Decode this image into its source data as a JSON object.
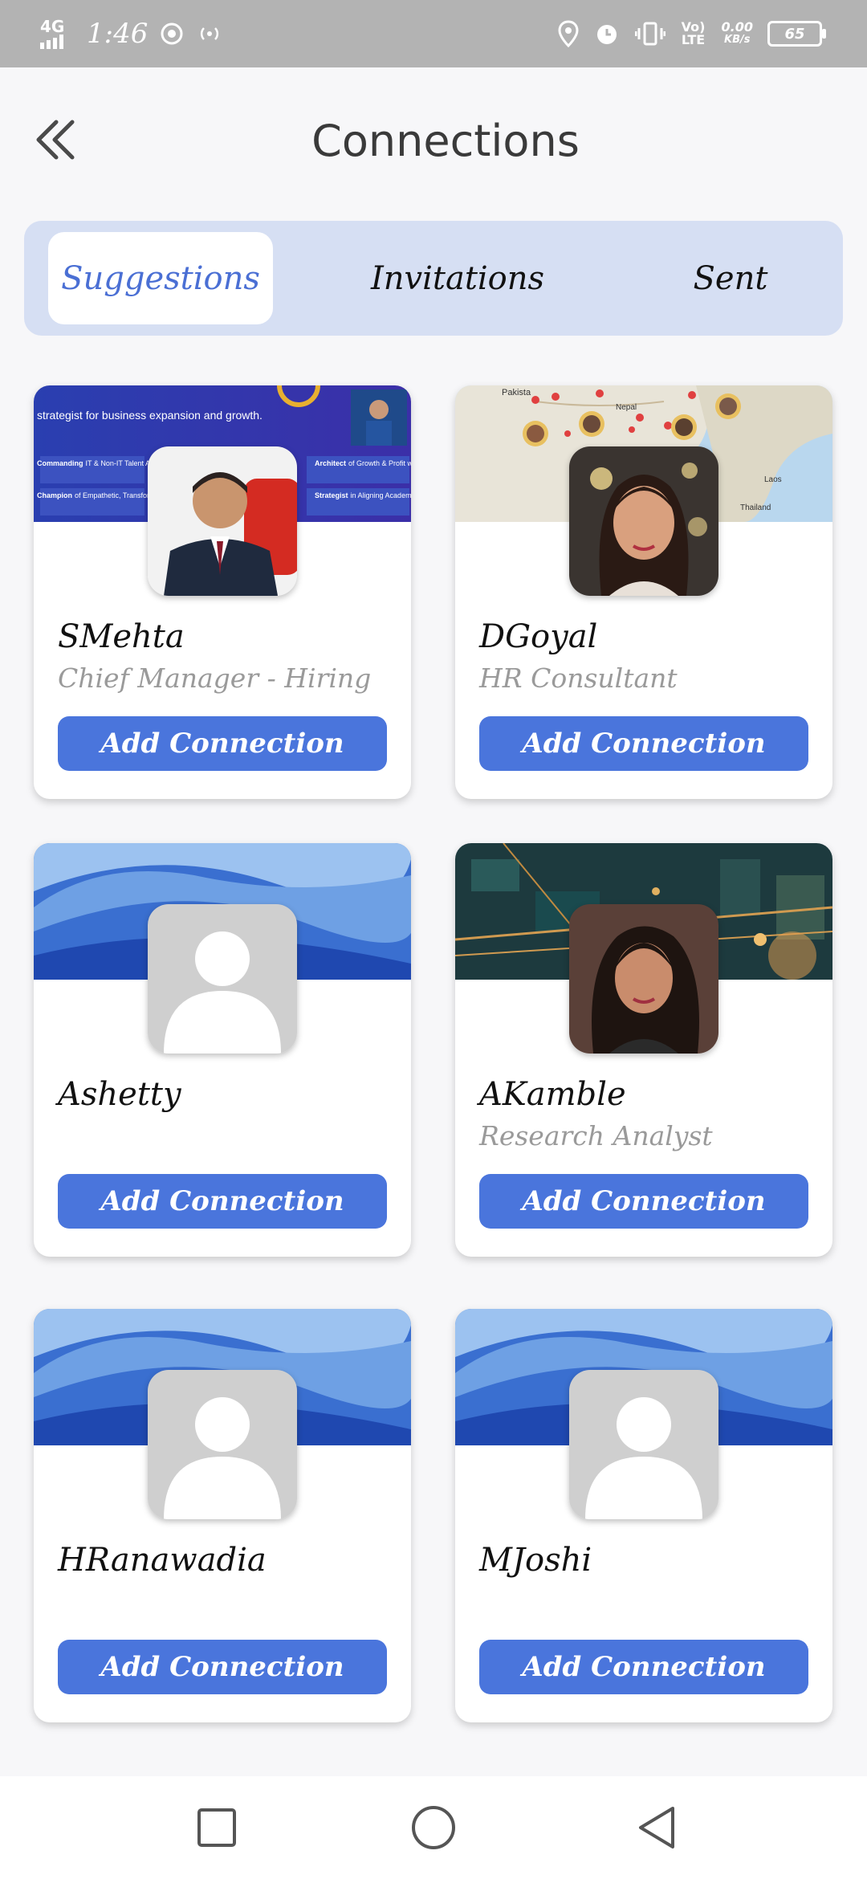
{
  "status_bar": {
    "network": "4G",
    "time": "1:46",
    "volte": "Vo) LTE",
    "speed_value": "0.00",
    "speed_unit": "KB/s",
    "battery": "65"
  },
  "header": {
    "title": "Connections",
    "back_icon": "double-chevron-left-icon"
  },
  "tabs": [
    {
      "label": "Suggestions",
      "active": true
    },
    {
      "label": "Invitations",
      "active": false
    },
    {
      "label": "Sent",
      "active": false
    }
  ],
  "cards": [
    {
      "name": "SMehta",
      "role": "Chief Manager - Hiring",
      "button": "Add Connection",
      "cover": "banner",
      "avatar": "photo-man"
    },
    {
      "name": "DGoyal",
      "role": "HR Consultant",
      "button": "Add Connection",
      "cover": "map",
      "avatar": "photo-woman"
    },
    {
      "name": "Ashetty",
      "role": "",
      "button": "Add Connection",
      "cover": "wave",
      "avatar": "placeholder"
    },
    {
      "name": "AKamble",
      "role": "Research Analyst",
      "button": "Add Connection",
      "cover": "circuit",
      "avatar": "photo-woman-2"
    },
    {
      "name": "HRanawadia",
      "role": "",
      "button": "Add Connection",
      "cover": "wave",
      "avatar": "placeholder"
    },
    {
      "name": "MJoshi",
      "role": "",
      "button": "Add Connection",
      "cover": "wave",
      "avatar": "placeholder"
    }
  ],
  "banner_text": {
    "tagline": "strategist for business expansion and growth.",
    "item1_bold": "Commanding",
    "item1_rest": "IT & Non-IT Talent Acquisition",
    "item2_bold": "Champion",
    "item2_rest": "of Empathetic, Transformative Leadership",
    "item3_bold": "Architect",
    "item3_rest": "of Growth & Profit w/ Cutting-Edge Market Tactics",
    "item4_bold": "Strategist",
    "item4_rest": "in Aligning Academic Brilliance with Industry Leader"
  },
  "map_labels": [
    "Pakista",
    "Nepal",
    "Thailand",
    "Laos"
  ],
  "nav": {
    "recent_icon": "square-icon",
    "home_icon": "circle-icon",
    "back_icon": "triangle-back-icon"
  },
  "colors": {
    "accent": "#4a75dc",
    "tab_bg": "#d6dff3",
    "active_tab_text": "#4a6fd4",
    "status_bar": "#b3b3b3"
  }
}
